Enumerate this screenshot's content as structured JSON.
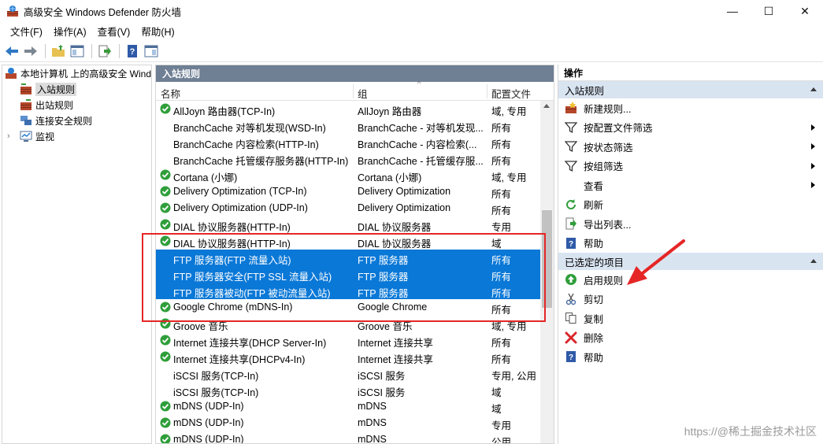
{
  "window": {
    "title": "高级安全 Windows Defender 防火墙",
    "min": "—",
    "max": "☐",
    "close": "✕"
  },
  "menu": [
    "文件(F)",
    "操作(A)",
    "查看(V)",
    "帮助(H)"
  ],
  "tree": {
    "root": "本地计算机 上的高级安全 Wind",
    "items": [
      "入站规则",
      "出站规则",
      "连接安全规则",
      "监视"
    ]
  },
  "middle": {
    "header": "入站规则",
    "columns": {
      "name": "名称",
      "group": "组",
      "profile": "配置文件"
    },
    "rows": [
      {
        "name": "AllJoyn 路由器(TCP-In)",
        "group": "AllJoyn 路由器",
        "profile": "域, 专用",
        "enabled": true,
        "selected": false
      },
      {
        "name": "BranchCache 对等机发现(WSD-In)",
        "group": "BranchCache - 对等机发现...",
        "profile": "所有",
        "enabled": false,
        "selected": false
      },
      {
        "name": "BranchCache 内容检索(HTTP-In)",
        "group": "BranchCache - 内容检索(...",
        "profile": "所有",
        "enabled": false,
        "selected": false
      },
      {
        "name": "BranchCache 托管缓存服务器(HTTP-In)",
        "group": "BranchCache - 托管缓存服...",
        "profile": "所有",
        "enabled": false,
        "selected": false
      },
      {
        "name": "Cortana (小娜)",
        "group": "Cortana (小娜)",
        "profile": "域, 专用",
        "enabled": true,
        "selected": false
      },
      {
        "name": "Delivery Optimization (TCP-In)",
        "group": "Delivery Optimization",
        "profile": "所有",
        "enabled": true,
        "selected": false
      },
      {
        "name": "Delivery Optimization (UDP-In)",
        "group": "Delivery Optimization",
        "profile": "所有",
        "enabled": true,
        "selected": false
      },
      {
        "name": "DIAL 协议服务器(HTTP-In)",
        "group": "DIAL 协议服务器",
        "profile": "专用",
        "enabled": true,
        "selected": false
      },
      {
        "name": "DIAL 协议服务器(HTTP-In)",
        "group": "DIAL 协议服务器",
        "profile": "域",
        "enabled": true,
        "selected": false
      },
      {
        "name": "FTP 服务器(FTP 流量入站)",
        "group": "FTP 服务器",
        "profile": "所有",
        "enabled": false,
        "selected": true
      },
      {
        "name": "FTP 服务器安全(FTP SSL 流量入站)",
        "group": "FTP 服务器",
        "profile": "所有",
        "enabled": false,
        "selected": true
      },
      {
        "name": "FTP 服务器被动(FTP 被动流量入站)",
        "group": "FTP 服务器",
        "profile": "所有",
        "enabled": false,
        "selected": true
      },
      {
        "name": "Google Chrome (mDNS-In)",
        "group": "Google Chrome",
        "profile": "所有",
        "enabled": true,
        "selected": false
      },
      {
        "name": "Groove 音乐",
        "group": "Groove 音乐",
        "profile": "域, 专用",
        "enabled": true,
        "selected": false
      },
      {
        "name": "Internet 连接共享(DHCP Server-In)",
        "group": "Internet 连接共享",
        "profile": "所有",
        "enabled": true,
        "selected": false
      },
      {
        "name": "Internet 连接共享(DHCPv4-In)",
        "group": "Internet 连接共享",
        "profile": "所有",
        "enabled": true,
        "selected": false
      },
      {
        "name": "iSCSI 服务(TCP-In)",
        "group": "iSCSI 服务",
        "profile": "专用, 公用",
        "enabled": false,
        "selected": false
      },
      {
        "name": "iSCSI 服务(TCP-In)",
        "group": "iSCSI 服务",
        "profile": "域",
        "enabled": false,
        "selected": false
      },
      {
        "name": "mDNS (UDP-In)",
        "group": "mDNS",
        "profile": "域",
        "enabled": true,
        "selected": false
      },
      {
        "name": "mDNS (UDP-In)",
        "group": "mDNS",
        "profile": "专用",
        "enabled": true,
        "selected": false
      },
      {
        "name": "mDNS (UDP-In)",
        "group": "mDNS",
        "profile": "公用",
        "enabled": true,
        "selected": false
      }
    ]
  },
  "actions": {
    "title": "操作",
    "section1": "入站规则",
    "list1": [
      {
        "label": "新建规则...",
        "icon": "new-rule-icon",
        "submenu": false
      },
      {
        "label": "按配置文件筛选",
        "icon": "filter-icon",
        "submenu": true
      },
      {
        "label": "按状态筛选",
        "icon": "filter-icon",
        "submenu": true
      },
      {
        "label": "按组筛选",
        "icon": "filter-icon",
        "submenu": true
      },
      {
        "label": "查看",
        "icon": "none",
        "submenu": true
      },
      {
        "label": "刷新",
        "icon": "refresh-icon",
        "submenu": false
      },
      {
        "label": "导出列表...",
        "icon": "export-icon",
        "submenu": false
      },
      {
        "label": "帮助",
        "icon": "help-icon",
        "submenu": false
      }
    ],
    "section2": "已选定的项目",
    "list2": [
      {
        "label": "启用规则",
        "icon": "enable-icon"
      },
      {
        "label": "剪切",
        "icon": "cut-icon"
      },
      {
        "label": "复制",
        "icon": "copy-icon"
      },
      {
        "label": "删除",
        "icon": "delete-icon"
      },
      {
        "label": "帮助",
        "icon": "help-icon"
      }
    ]
  },
  "watermark": "https://@稀土掘金技术社区"
}
